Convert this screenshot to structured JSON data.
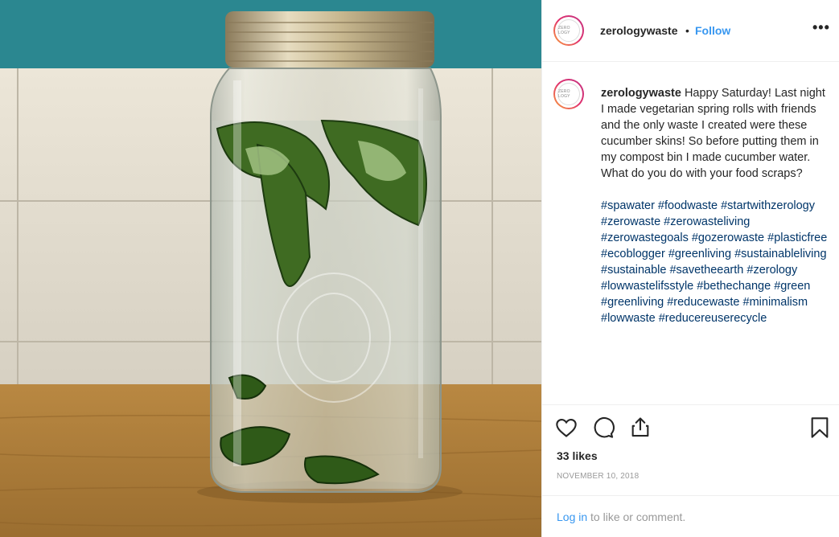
{
  "post": {
    "username": "zerologywaste",
    "separator": "•",
    "follow_label": "Follow",
    "more_icon": "more-options-icon",
    "more_glyph": "•••",
    "avatar_text": "ZERO LOGY",
    "caption_text": "Happy Saturday! Last night I made vegetarian spring rolls with friends and the only waste I created were these cucumber skins! So before putting them in my compost bin I made cucumber water. What do you do with your food scraps?",
    "hashtags": "#spawater #foodwaste #startwithzerology #zerowaste #zerowasteliving #zerowastegoals #gozerowaste #plasticfree #ecoblogger #greenliving #sustainableliving #sustainable #savetheearth #zerology #lowwastelifsstyle #bethechange #green #greenliving #reducewaste #minimalism #lowwaste #reducereuserecycle",
    "likes": "33 likes",
    "date": "NOVEMBER 10, 2018",
    "login_link": "Log in",
    "login_rest": " to like or comment."
  },
  "icons": [
    "heart-icon",
    "comment-icon",
    "share-icon",
    "bookmark-icon"
  ],
  "colors": {
    "accent": "#3897f0",
    "hashtag": "#003569",
    "muted": "#999999",
    "text": "#262626"
  }
}
